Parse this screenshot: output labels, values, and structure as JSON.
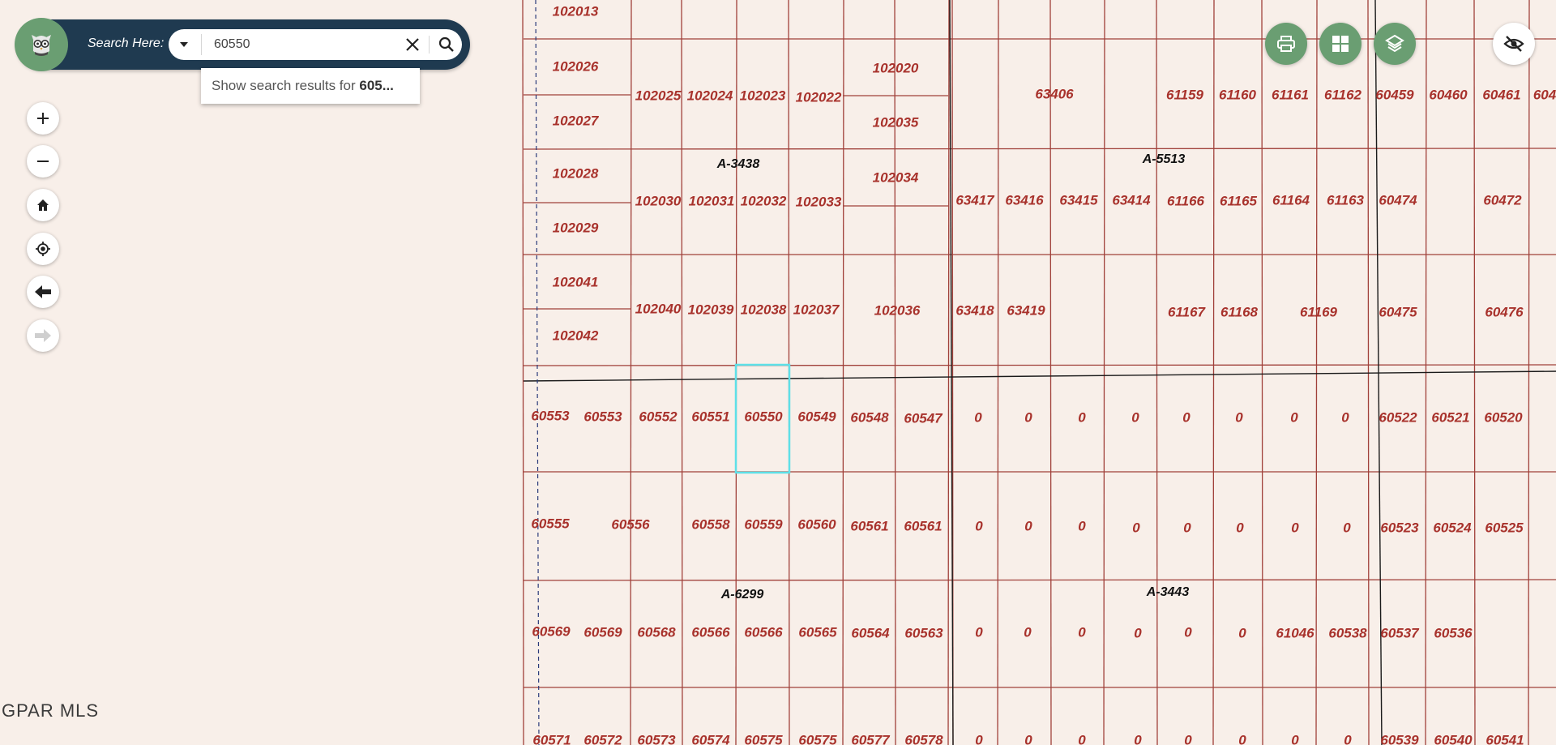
{
  "search": {
    "label": "Search Here:",
    "value": "60550",
    "suggestion_prefix": "Show search results for ",
    "suggestion_term": "605..."
  },
  "watermark": "GPAR MLS",
  "icons": {
    "logo": "owl-logo-icon",
    "dropdown": "caret-down-icon",
    "clear": "close-icon",
    "search": "search-icon",
    "zoom_in": "plus-icon",
    "zoom_out": "minus-icon",
    "home": "home-icon",
    "locate": "locate-icon",
    "back": "arrow-left-icon",
    "forward": "arrow-right-icon",
    "print": "print-icon",
    "basemap": "grid-icon",
    "layers": "layers-icon",
    "hide": "eye-off-icon"
  },
  "colors": {
    "map_bg": "#f8efe9",
    "parcel_line": "#a0403a",
    "parcel_text": "#a8322c",
    "selected": "#5ee0e8",
    "brand_green": "#6a9e72",
    "brand_navy": "#1f3a50"
  },
  "map": {
    "selected_parcel": "60550",
    "abstracts": [
      "A-3438",
      "A-5513",
      "A-6299",
      "A-3443"
    ],
    "parcels": [
      [
        "102013"
      ],
      [
        "102026",
        "102027",
        "102028",
        "102029",
        "102041",
        "102042"
      ],
      [
        "102025",
        "102024",
        "102023",
        "102022",
        "102020",
        "102035"
      ],
      [
        "102030",
        "102031",
        "102032",
        "102033",
        "102034"
      ],
      [
        "102040",
        "102039",
        "102038",
        "102037",
        "102036"
      ],
      [
        "63406",
        "61159",
        "61160",
        "61161",
        "61162",
        "60459",
        "60460",
        "60461",
        "604"
      ],
      [
        "63417",
        "63416",
        "63415",
        "63414",
        "61166",
        "61165",
        "61164",
        "61163",
        "60474",
        "60472"
      ],
      [
        "63418",
        "63419",
        "61167",
        "61168",
        "61169",
        "60475",
        "60476"
      ],
      [
        "60553",
        "60553",
        "60552",
        "60551",
        "60550",
        "60549",
        "60548",
        "60547",
        "0",
        "0",
        "0",
        "0",
        "0",
        "0",
        "0",
        "0",
        "60522",
        "60521",
        "60520"
      ],
      [
        "60555",
        "60556",
        "60558",
        "60559",
        "60560",
        "60561",
        "60561",
        "0",
        "0",
        "0",
        "0",
        "0",
        "0",
        "0",
        "0",
        "60523",
        "60524",
        "60525"
      ],
      [
        "60569",
        "60569",
        "60568",
        "60566",
        "60566",
        "60565",
        "60564",
        "60563",
        "0",
        "0",
        "0",
        "0",
        "0",
        "0",
        "61046",
        "60538",
        "60537",
        "60536"
      ],
      [
        "60571",
        "60572",
        "60573",
        "60574",
        "60575",
        "60575",
        "60577",
        "60578",
        "0",
        "0",
        "0",
        "0",
        "0",
        "0",
        "0",
        "0",
        "60539",
        "60540",
        "60541"
      ]
    ]
  }
}
